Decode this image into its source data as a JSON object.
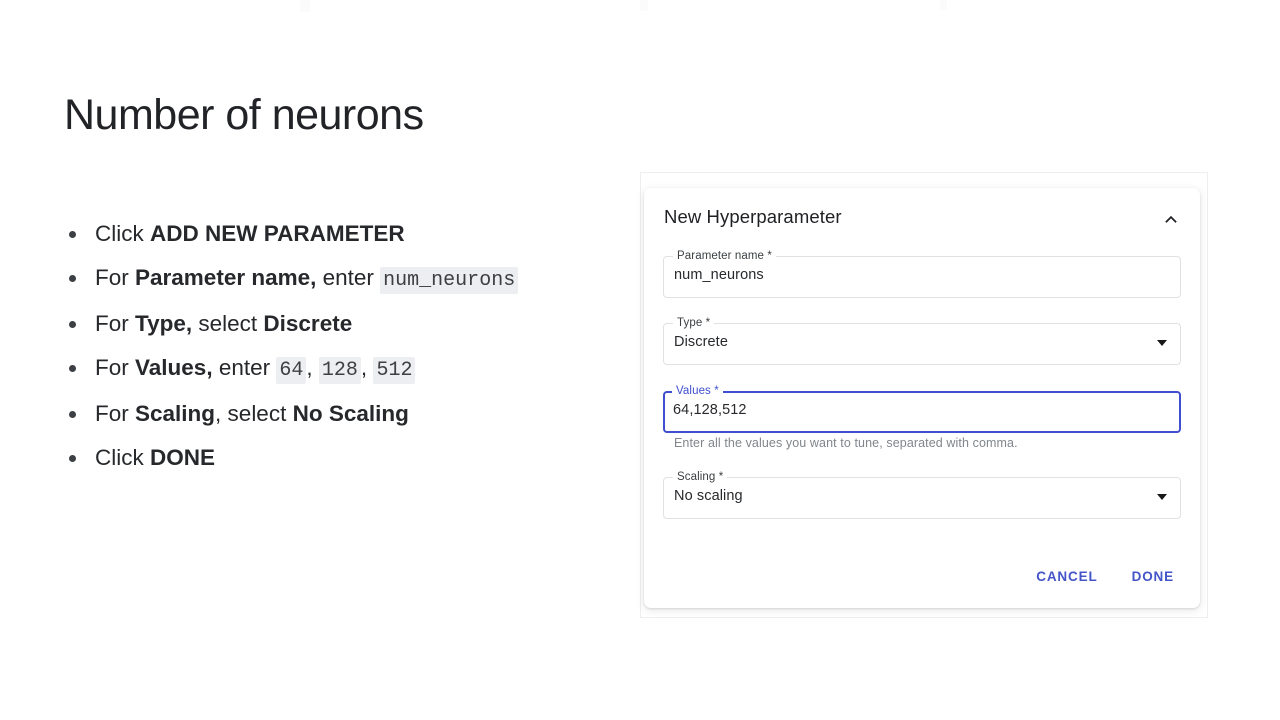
{
  "slide": {
    "title": "Number of neurons"
  },
  "instructions": [
    {
      "id": "click-add-new-parameter",
      "parts": [
        {
          "text": "Click ",
          "style": "normal"
        },
        {
          "text": "ADD NEW PARAMETER",
          "style": "bold"
        }
      ]
    },
    {
      "id": "enter-parameter-name",
      "parts": [
        {
          "text": "For ",
          "style": "normal"
        },
        {
          "text": "Parameter name,",
          "style": "bold"
        },
        {
          "text": " enter ",
          "style": "normal"
        },
        {
          "text": "num_neurons",
          "style": "code"
        }
      ]
    },
    {
      "id": "select-type",
      "parts": [
        {
          "text": "For ",
          "style": "normal"
        },
        {
          "text": "Type,",
          "style": "bold"
        },
        {
          "text": " select ",
          "style": "normal"
        },
        {
          "text": "Discrete",
          "style": "bold"
        }
      ]
    },
    {
      "id": "enter-values",
      "parts": [
        {
          "text": "For ",
          "style": "normal"
        },
        {
          "text": "Values,",
          "style": "bold"
        },
        {
          "text": " enter ",
          "style": "normal"
        },
        {
          "text": "64",
          "style": "code"
        },
        {
          "text": ", ",
          "style": "normal"
        },
        {
          "text": "128",
          "style": "code"
        },
        {
          "text": ", ",
          "style": "normal"
        },
        {
          "text": "512",
          "style": "code"
        }
      ]
    },
    {
      "id": "select-scaling",
      "parts": [
        {
          "text": "For ",
          "style": "normal"
        },
        {
          "text": "Scaling",
          "style": "bold"
        },
        {
          "text": ", select ",
          "style": "normal"
        },
        {
          "text": "No Scaling",
          "style": "bold"
        }
      ]
    },
    {
      "id": "click-done",
      "parts": [
        {
          "text": "Click ",
          "style": "normal"
        },
        {
          "text": "DONE",
          "style": "bold"
        }
      ]
    }
  ],
  "card": {
    "title": "New Hyperparameter",
    "collapse_icon": "chevron-up-icon",
    "fields": {
      "parameter_name": {
        "label": "Parameter name *",
        "value": "num_neurons",
        "type": "text",
        "focused": false
      },
      "type": {
        "label": "Type *",
        "value": "Discrete",
        "type": "select",
        "icon": "dropdown-arrow-icon",
        "focused": false
      },
      "values": {
        "label": "Values *",
        "value": "64,128,512",
        "type": "text",
        "focused": true,
        "hint": "Enter all the values you want to tune, separated with comma."
      },
      "scaling": {
        "label": "Scaling *",
        "value": "No scaling",
        "type": "select",
        "icon": "dropdown-arrow-icon",
        "focused": false
      }
    },
    "actions": {
      "cancel_label": "CANCEL",
      "done_label": "DONE"
    }
  },
  "colors": {
    "accent": "#3f4fcf",
    "button_text": "#4355c8",
    "code_background": "#eceef1",
    "field_border": "#dfe1e4",
    "hint_text": "#80868b",
    "title_text": "#212326"
  }
}
